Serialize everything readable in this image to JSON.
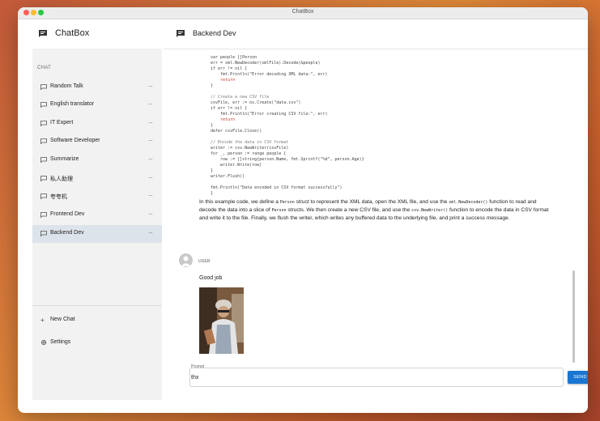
{
  "window": {
    "title": "ChatBox"
  },
  "sidebar": {
    "app_name": "ChatBox",
    "section_label": "CHAT",
    "conversations": [
      {
        "label": "Random Talk"
      },
      {
        "label": "English translator"
      },
      {
        "label": "IT Expert"
      },
      {
        "label": "Software Developer"
      },
      {
        "label": "Summarize"
      },
      {
        "label": "私人助理"
      },
      {
        "label": "夸夸机"
      },
      {
        "label": "Frontend Dev"
      },
      {
        "label": "Backend Dev",
        "active": true
      }
    ],
    "more_glyph": "···",
    "new_chat_label": "New Chat",
    "settings_label": "Settings"
  },
  "main": {
    "chat_title": "Backend Dev",
    "code_lines": [
      "var people []Person",
      "err = xml.NewDecoder(xmlFile).Decode(&people)",
      "if err != nil {",
      "    fmt.Println(\"Error decoding XML data:\", err)",
      "    return",
      "}",
      "",
      "// Create a new CSV file",
      "csvFile, err := os.Create(\"data.csv\")",
      "if err != nil {",
      "    fmt.Println(\"Error creating CSV file:\", err)",
      "    return",
      "}",
      "defer csvFile.Close()",
      "",
      "// Encode the data in CSV format",
      "writer := csv.NewWriter(csvFile)",
      "for _, person := range people {",
      "    row := []string{person.Name, fmt.Sprintf(\"%d\", person.Age)}",
      "    writer.Write(row)",
      "}",
      "writer.Flush()",
      "",
      "fmt.Println(\"Data encoded in CSV format successfully\")",
      "}"
    ],
    "explanation": {
      "p1": "In this example code, we define a ",
      "c1": "Person",
      "p2": " struct to represent the XML data, open the XML file, and use the ",
      "c2": "xml.NewDecoder()",
      "p3": " function to read and decode the data into a slice of ",
      "c3": "Person",
      "p4": " structs. We then create a new CSV file, and use the ",
      "c4": "csv.NewWriter()",
      "p5": " function to encode the data in CSV format and write it to the file. Finally, we flush the writer, which writes any buffered data to the underlying file, and print a success message."
    },
    "user_message": {
      "role": "USER",
      "text": "Good job"
    },
    "prompt": {
      "label": "Prompt",
      "value": "thx"
    },
    "send_label": "SEND"
  },
  "colors": {
    "accent": "#1976d2",
    "active_item": "#dde3ea",
    "sidebar_bg": "#f2f2f2"
  },
  "icons": [
    "chat-bubble-icon",
    "plus-icon",
    "gear-icon",
    "user-avatar-icon",
    "more-dots-icon"
  ]
}
